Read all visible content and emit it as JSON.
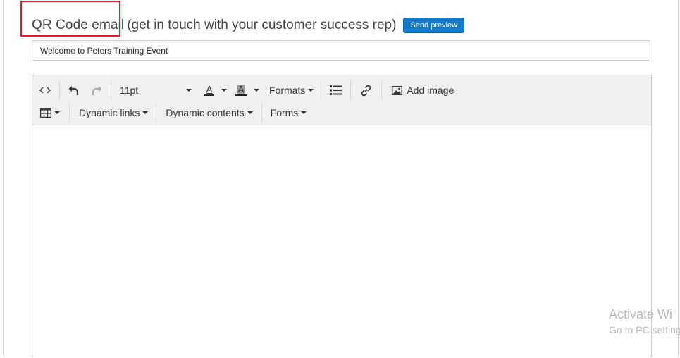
{
  "header": {
    "title": "QR Code email",
    "subtitle": "(get in touch with your customer success rep)",
    "send_preview_label": "Send preview"
  },
  "subject": {
    "value": "Welcome to Peters Training Event"
  },
  "toolbar": {
    "row1": {
      "font_size": "11pt",
      "formats_label": "Formats",
      "add_image_label": "Add image",
      "text_color_glyph": "A",
      "bg_color_glyph": "A"
    },
    "row2": {
      "dynamic_links_label": "Dynamic links",
      "dynamic_contents_label": "Dynamic contents",
      "forms_label": "Forms"
    }
  },
  "watermark": {
    "line1": "Activate Wi",
    "line2": "Go to PC setting"
  },
  "colors": {
    "accent": "#1479c9",
    "highlight": "#e02030",
    "toolbar_bg": "#f0f0f0"
  }
}
